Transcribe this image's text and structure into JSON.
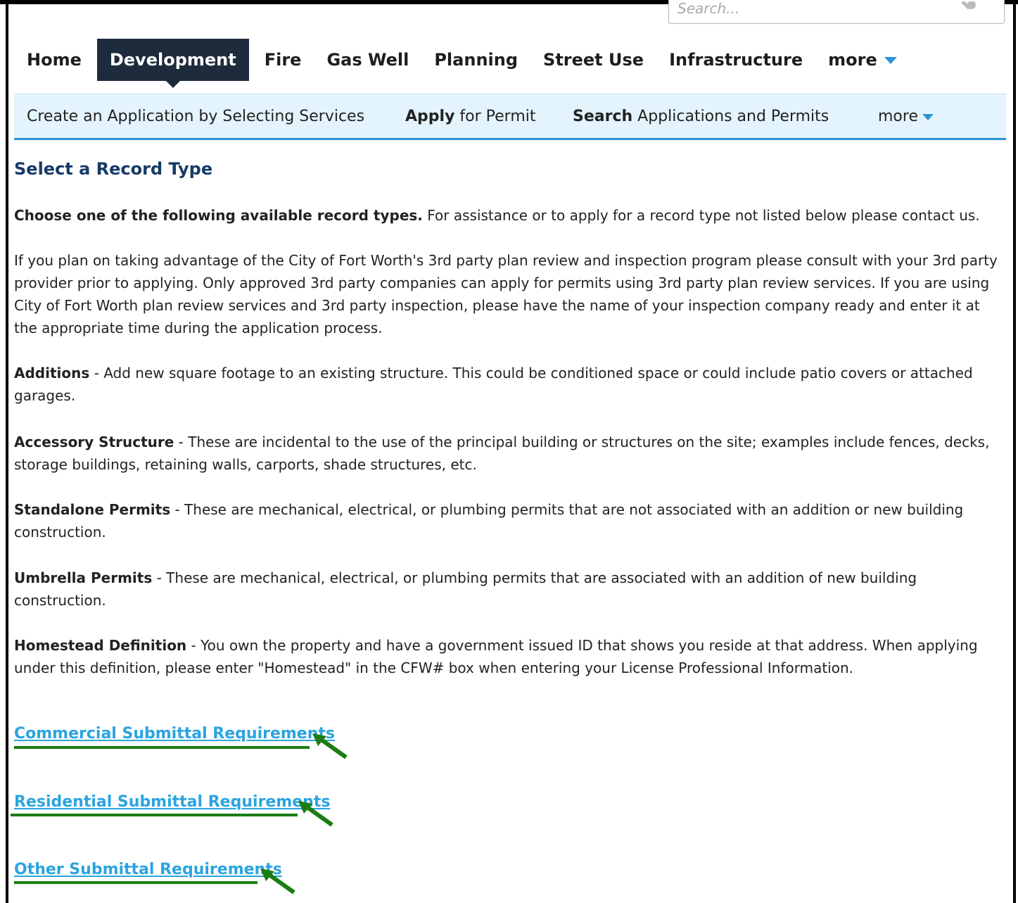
{
  "search": {
    "placeholder": "Search..."
  },
  "main_nav": {
    "tabs": [
      "Home",
      "Development",
      "Fire",
      "Gas Well",
      "Planning",
      "Street Use",
      "Infrastructure"
    ],
    "active": "Development",
    "more_label": "more"
  },
  "sub_nav": {
    "create_application": "Create an Application by Selecting Services",
    "apply_bold": "Apply",
    "apply_rest": " for Permit",
    "search_bold": "Search",
    "search_rest": " Applications and Permits",
    "more_label": "more"
  },
  "content": {
    "title": "Select a Record Type",
    "intro_bold": "Choose one of the following available record types.",
    "intro_rest": " For assistance or to apply for a record type not listed below please contact us.",
    "third_party": "If you plan on taking advantage of the City of Fort Worth's 3rd party plan review and inspection program please consult with your 3rd party provider prior to applying. Only approved 3rd party companies can apply for permits using 3rd party plan review services. If you are using City of Fort Worth plan review services and 3rd party inspection, please have the name of your inspection company ready and enter it at the appropriate time during the application process.",
    "definitions": [
      {
        "term": "Additions",
        "text": " - Add new square footage to an existing structure. This could be conditioned space or could include patio covers or attached garages."
      },
      {
        "term": "Accessory Structure",
        "text": " - These are incidental to the use of the principal building or structures on the site; examples include fences, decks, storage buildings, retaining walls, carports, shade structures, etc."
      },
      {
        "term": "Standalone Permits",
        "text": " - These are mechanical, electrical, or plumbing permits that are not associated with an addition or new building construction."
      },
      {
        "term": "Umbrella Permits",
        "text": " - These are mechanical, electrical, or plumbing permits that are associated with an addition of new building construction."
      },
      {
        "term": "Homestead Definition",
        "text": " - You own the property and have a government issued ID that shows you reside at that address.  When applying under this definition, please enter \"Homestead\" in the CFW# box when entering your License Professional Information."
      }
    ],
    "links": [
      "Commercial Submittal Requirements",
      "Residential Submittal Requirements",
      "Other Submittal Requirements"
    ]
  },
  "colors": {
    "nav_active_bg": "#1e2b3c",
    "subnav_bg": "#e4f4fc",
    "accent_blue": "#2a94d8",
    "link": "#2ba4e0",
    "title": "#163b67",
    "annotation_green": "#1a7d12"
  }
}
